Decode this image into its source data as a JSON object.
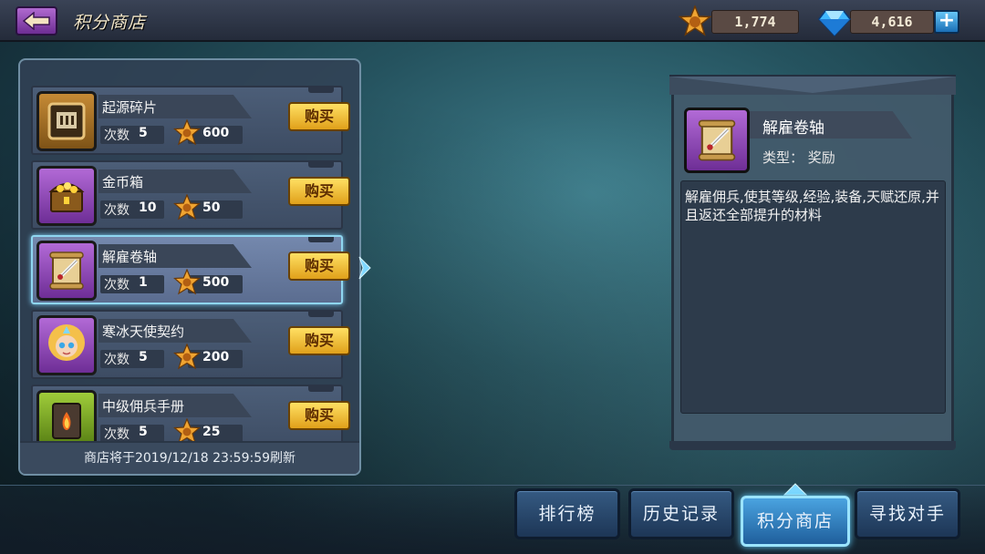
{
  "header": {
    "title": "积分商店",
    "star_points": "1,774",
    "gems": "4,616",
    "plus": "+"
  },
  "shop": {
    "count_label": "次数",
    "buy_label": "购买",
    "items": [
      {
        "name": "起源碎片",
        "count": "5",
        "price": "600",
        "icon": "origin-fragment-icon"
      },
      {
        "name": "金币箱",
        "count": "10",
        "price": "50",
        "icon": "gold-chest-icon"
      },
      {
        "name": "解雇卷轴",
        "count": "1",
        "price": "500",
        "icon": "dismiss-scroll-icon"
      },
      {
        "name": "寒冰天使契约",
        "count": "5",
        "price": "200",
        "icon": "ice-angel-portrait-icon"
      },
      {
        "name": "中级佣兵手册",
        "count": "5",
        "price": "25",
        "icon": "mercenary-manual-icon"
      }
    ],
    "selected_index": 2,
    "refresh_text": "商店将于2019/12/18 23:59:59刷新"
  },
  "detail": {
    "name": "解雇卷轴",
    "type": "类型：  奖励",
    "description": "解雇佣兵,使其等级,经验,装备,天赋还原,并且返还全部提升的材料"
  },
  "tabs": [
    {
      "label": "排行榜"
    },
    {
      "label": "历史记录"
    },
    {
      "label": "积分商店"
    },
    {
      "label": "寻找对手"
    }
  ],
  "colors": {
    "buy_button": "#f2c23a",
    "selected_border": "#8fd6f0",
    "active_tab": "#4aa3e0"
  }
}
